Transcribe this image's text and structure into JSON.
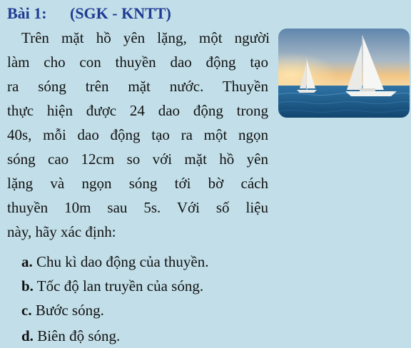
{
  "exercise": {
    "number": "Bài 1:",
    "source": "(SGK - KNTT)"
  },
  "paragraph": {
    "lines": [
      "Trên mặt hồ yên lặng, một người",
      "làm cho con thuyền dao động tạo",
      "ra sóng trên mặt nước. Thuyền",
      "thực hiện được 24 dao động trong",
      "40s, mỗi dao động tạo ra một ngọn",
      "sóng cao 12cm so với mặt hồ yên",
      "lặng và ngọn sóng tới bờ cách",
      "thuyền 10m sau 5s. Với số liệu",
      "này, hãy xác định:"
    ]
  },
  "questions": [
    {
      "label": "a.",
      "text": " Chu kì dao động của thuyền."
    },
    {
      "label": "b.",
      "text": " Tốc độ lan truyền của sóng."
    },
    {
      "label": "c.",
      "text": " Bước sóng."
    },
    {
      "label": "d.",
      "text": " Biên độ sóng."
    }
  ],
  "image": {
    "icon": "sailboat-photo",
    "colors": {
      "sky_top": "#6e93b8",
      "sky_glow": "#f4c27a",
      "sea": "#1f5f8f",
      "sail": "#f4f4f2"
    }
  }
}
